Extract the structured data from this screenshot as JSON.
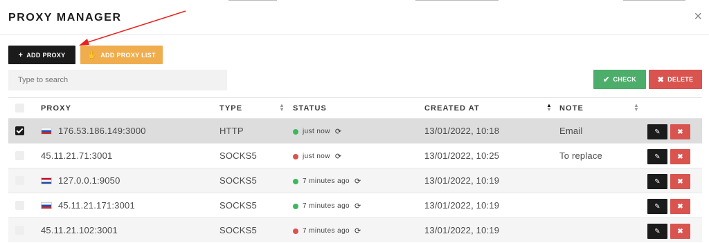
{
  "modal": {
    "title": "PROXY MANAGER",
    "close": "×"
  },
  "toolbar": {
    "add_proxy": "ADD PROXY",
    "add_proxy_icon": "+",
    "add_list": "ADD PROXY LIST",
    "add_list_icon": "✋",
    "check": "CHECK",
    "check_icon": "✔",
    "delete": "DELETE",
    "delete_icon": "✖"
  },
  "search": {
    "placeholder": "Type to search",
    "value": ""
  },
  "table": {
    "headers": {
      "proxy": "PROXY",
      "type": "TYPE",
      "status": "STATUS",
      "created": "CREATED AT",
      "note": "NOTE"
    },
    "rows": [
      {
        "checked": true,
        "flag": "russia-flag-icon",
        "proxy": "176.53.186.149:3000",
        "type": "HTTP",
        "status_color": "#3cb85f",
        "status": "just now",
        "created": "13/01/2022, 10:18",
        "note": "Email"
      },
      {
        "checked": false,
        "flag": "",
        "proxy": "45.11.21.71:3001",
        "type": "SOCKS5",
        "status_color": "#d9534f",
        "status": "just now",
        "created": "13/01/2022, 10:25",
        "note": "To replace"
      },
      {
        "checked": false,
        "flag": "netherlands-flag-icon",
        "proxy": "127.0.0.1:9050",
        "type": "SOCKS5",
        "status_color": "#3cb85f",
        "status": "7 minutes ago",
        "created": "13/01/2022, 10:19",
        "note": ""
      },
      {
        "checked": false,
        "flag": "russia-flag-icon",
        "proxy": "45.11.21.171:3001",
        "type": "SOCKS5",
        "status_color": "#3cb85f",
        "status": "7 minutes ago",
        "created": "13/01/2022, 10:19",
        "note": ""
      },
      {
        "checked": false,
        "flag": "",
        "proxy": "45.11.21.102:3001",
        "type": "SOCKS5",
        "status_color": "#d9534f",
        "status": "7 minutes ago",
        "created": "13/01/2022, 10:19",
        "note": ""
      }
    ]
  },
  "icons": {
    "refresh": "⟳",
    "edit": "✎",
    "remove": "✖"
  },
  "colors": {
    "dark": "#1b1b1b",
    "orange": "#f0ad4e",
    "green": "#4cae6a",
    "red": "#d9534f",
    "annotation_arrow": "#e8231f"
  }
}
